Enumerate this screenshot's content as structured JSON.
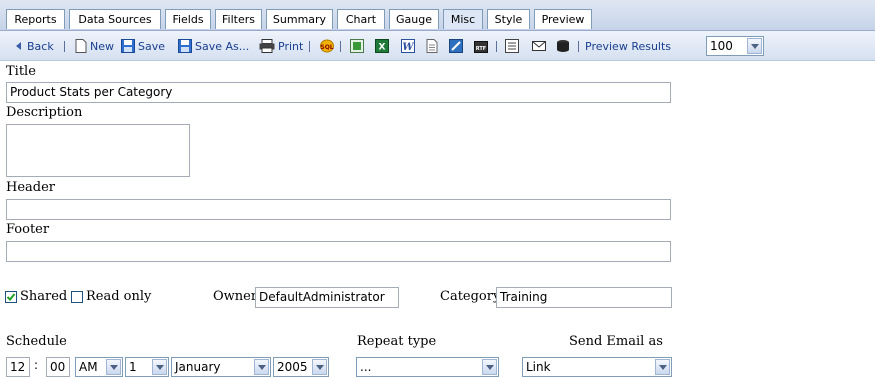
{
  "tabs": [
    {
      "label": "Reports"
    },
    {
      "label": "Data Sources"
    },
    {
      "label": "Fields"
    },
    {
      "label": "Filters"
    },
    {
      "label": "Summary"
    },
    {
      "label": "Chart"
    },
    {
      "label": "Gauge"
    },
    {
      "label": "Misc",
      "active": true
    },
    {
      "label": "Style"
    },
    {
      "label": "Preview"
    }
  ],
  "toolbar": {
    "back": "Back",
    "new": "New",
    "save": "Save",
    "save_as": "Save As...",
    "print": "Print",
    "preview_results": "Preview Results",
    "preview_count": "100",
    "icons": [
      "sql-icon",
      "csv-icon",
      "excel-icon",
      "word-icon",
      "text-icon",
      "pdf-icon",
      "rtf-icon",
      "list-icon",
      "email-icon",
      "database-icon"
    ]
  },
  "form": {
    "title_label": "Title",
    "title_value": "Product Stats per Category",
    "description_label": "Description",
    "description_value": "",
    "header_label": "Header",
    "header_value": "",
    "footer_label": "Footer",
    "footer_value": "",
    "shared_label": "Shared",
    "shared_checked": true,
    "readonly_label": "Read only",
    "readonly_checked": false,
    "owner_label": "Owner",
    "owner_value": "DefaultAdministrator",
    "category_label": "Category",
    "category_value": "Training"
  },
  "schedule": {
    "label": "Schedule",
    "hour": "12",
    "colon": ":",
    "minute": "00",
    "ampm": "AM",
    "day": "1",
    "month": "January",
    "year": "2005",
    "repeat_label": "Repeat type",
    "repeat_value": "...",
    "send_label": "Send Email as",
    "send_value": "Link"
  },
  "colors": {
    "tab_active": "#dde6f5",
    "toolbar_text": "#1a3f8f",
    "border": "#7f9db9"
  }
}
